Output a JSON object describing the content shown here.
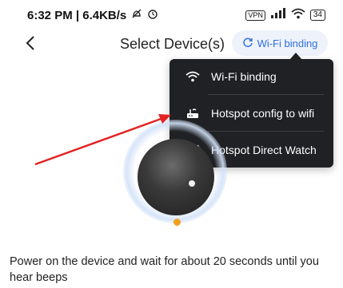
{
  "status_bar": {
    "time_speed": "6:32 PM | 6.4KB/s",
    "left_icons": [
      "no-notification-icon",
      "alarm-icon"
    ],
    "vpn": "VPN",
    "signal": "4G",
    "battery": "34"
  },
  "header": {
    "back_icon": "chevron-left-icon",
    "title": "Select Device(s)",
    "wifi_binding_button": "Wi-Fi binding",
    "wifi_binding_icon": "refresh-icon",
    "accent_color": "#2f6fe0"
  },
  "dropdown": {
    "items": [
      {
        "label": "Wi-Fi binding",
        "icon": "wifi-icon"
      },
      {
        "label": "Hotspot config to wifi",
        "icon": "router-icon"
      },
      {
        "label": "Hotspot Direct Watch",
        "icon": "hotspot-icon"
      }
    ]
  },
  "annotation": {
    "arrow_color": "#e32222"
  },
  "main": {
    "instruction": "Power on the device and wait for about 20 seconds until you hear beeps"
  }
}
